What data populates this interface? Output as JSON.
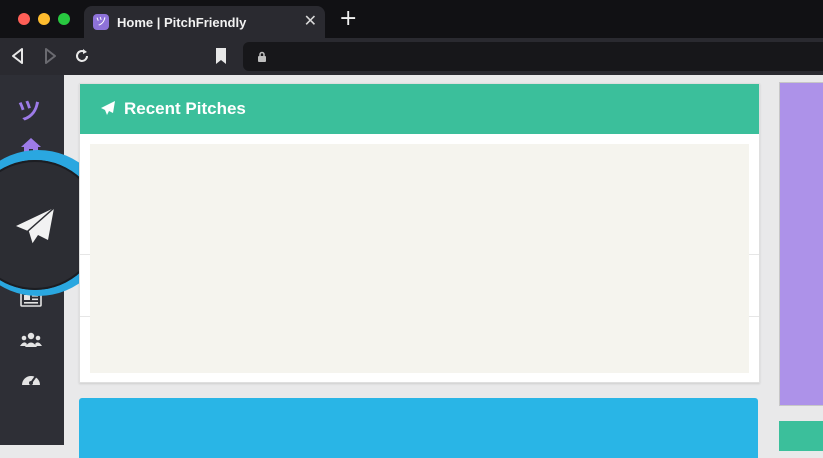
{
  "browser": {
    "tab_title": "Home | PitchFriendly",
    "tab_favicon": "ツ",
    "tab_close": "✕",
    "new_tab": "+",
    "url": ""
  },
  "app": {
    "logo": "ツ",
    "sidebar_icons": [
      "home-icon",
      "paper-plane-icon",
      "newspaper-icon",
      "users-icon",
      "dashboard-gauge-icon"
    ]
  },
  "main": {
    "recent_pitches": {
      "title": "Recent Pitches",
      "icon": "paper-plane-icon"
    }
  },
  "colors": {
    "accent_green": "#3bbf9b",
    "accent_blue": "#29b5e6",
    "accent_purple": "#ad92e9",
    "highlight_ring": "#2aa7e0"
  }
}
